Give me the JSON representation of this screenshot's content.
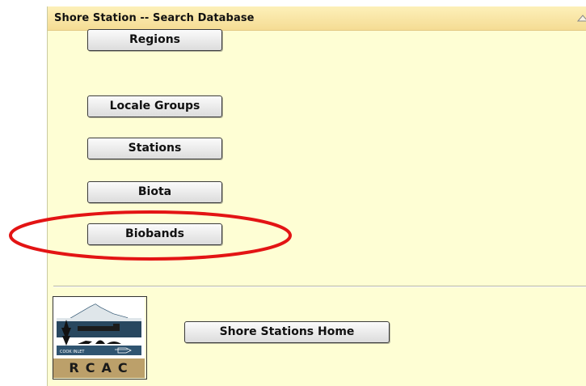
{
  "panel": {
    "title": "Shore Station -- Search Database"
  },
  "buttons": [
    {
      "label": "Regions"
    },
    {
      "label": "Locale Groups"
    },
    {
      "label": "Stations"
    },
    {
      "label": "Biota"
    },
    {
      "label": "Biobands"
    }
  ],
  "footer": {
    "logo_text": "RCAC",
    "logo_small_text": "COOK INLET",
    "home_button_label": "Shore Stations Home"
  },
  "colors": {
    "panel_bg": "#fefed4",
    "header_bg": "#f5dc94",
    "highlight_ellipse": "#e31414",
    "logo_band": "#bca06a"
  }
}
